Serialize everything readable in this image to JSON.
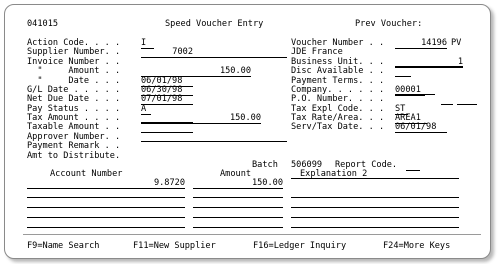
{
  "header": {
    "screen_id": "041015",
    "title": "Speed Voucher Entry",
    "prev_voucher_label": "Prev Voucher:"
  },
  "left": {
    "action_code": {
      "label": "Action Code. . . .",
      "value": "I"
    },
    "supplier_number": {
      "label": "Supplier Number. .",
      "value": "7002"
    },
    "invoice_number": {
      "label": "Invoice Number . .",
      "value": ""
    },
    "amount": {
      "label": "  \"     Amount . .",
      "value": "150.00"
    },
    "date": {
      "label": "  \"     Date . . .",
      "value": "06/01/98"
    },
    "gl_date": {
      "label": "G/L Date . . . . .",
      "value": "06/30/98"
    },
    "net_due_date": {
      "label": "Net Due Date . . .",
      "value": "07/01/98"
    },
    "pay_status": {
      "label": "Pay Status . . . .",
      "value": "A"
    },
    "tax_amount": {
      "label": "Tax Amount . . . .",
      "value": "150.00"
    },
    "taxable_amount": {
      "label": "Taxable Amount . .",
      "value": ""
    },
    "approver_number": {
      "label": "Approver Number. .",
      "value": ""
    },
    "payment_remark": {
      "label": "Payment Remark . .",
      "value": ""
    },
    "amt_to_distribute": {
      "label": "Amt to Distribute."
    }
  },
  "right": {
    "voucher_number": {
      "label": "Voucher Number . .",
      "value": "14196",
      "doc_type": "PV"
    },
    "supplier_name": "JDE France",
    "business_unit": {
      "label": "Business Unit. . .",
      "value": "1"
    },
    "disc_available": {
      "label": "Disc Available . .",
      "value": ""
    },
    "payment_terms": {
      "label": "Payment Terms. . .",
      "value": ""
    },
    "company": {
      "label": "Company. . . . . .",
      "value": "00001"
    },
    "po_number": {
      "label": "P.O. Number. . . .",
      "value": ""
    },
    "tax_expl_code": {
      "label": "Tax Expl Code. . .",
      "value": "ST"
    },
    "tax_rate_area": {
      "label": "Tax Rate/Area. . .",
      "value": "AREA1"
    },
    "serv_tax_date": {
      "label": "Serv/Tax Date. . .",
      "value": "06/01/98"
    }
  },
  "batch": {
    "label": "Batch",
    "value": "506099",
    "report_code_label": "Report Code."
  },
  "grid": {
    "headers": {
      "account_number": "Account Number",
      "amount": "Amount",
      "explanation": "Explanation 2"
    },
    "rows": [
      {
        "account_number": "9.8720",
        "amount": "150.00",
        "explanation": ""
      }
    ]
  },
  "function_keys": {
    "f9": "F9=Name Search",
    "f11": "F11=New Supplier",
    "f16": "F16=Ledger Inquiry",
    "f24": "F24=More Keys"
  }
}
